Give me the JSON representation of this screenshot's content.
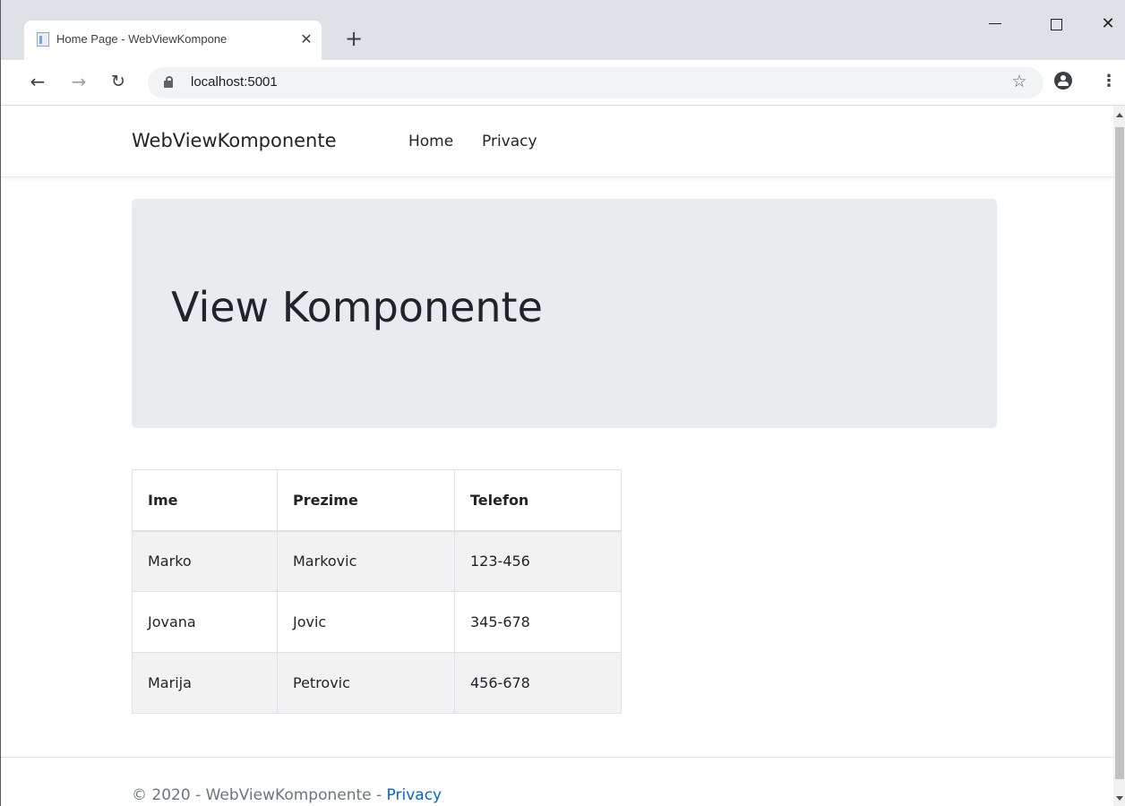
{
  "browser": {
    "tab_title": "Home Page - WebViewKompone",
    "tab_close": "✕",
    "new_tab": "+",
    "url": "localhost:5001",
    "window_close": "✕"
  },
  "nav": {
    "brand": "WebViewKomponente",
    "links": [
      "Home",
      "Privacy"
    ]
  },
  "hero": {
    "title": "View Komponente"
  },
  "table": {
    "headers": [
      "Ime",
      "Prezime",
      "Telefon"
    ],
    "rows": [
      [
        "Marko",
        "Markovic",
        "123-456"
      ],
      [
        "Jovana",
        "Jovic",
        "345-678"
      ],
      [
        "Marija",
        "Petrovic",
        "456-678"
      ]
    ]
  },
  "footer": {
    "prefix": "© 2020 - WebViewKomponente - ",
    "link": "Privacy"
  },
  "colors": {
    "tabstrip": "#dee1e6",
    "jumbotron": "#e9ecef",
    "link": "#0366d6",
    "muted": "#6c757d"
  }
}
